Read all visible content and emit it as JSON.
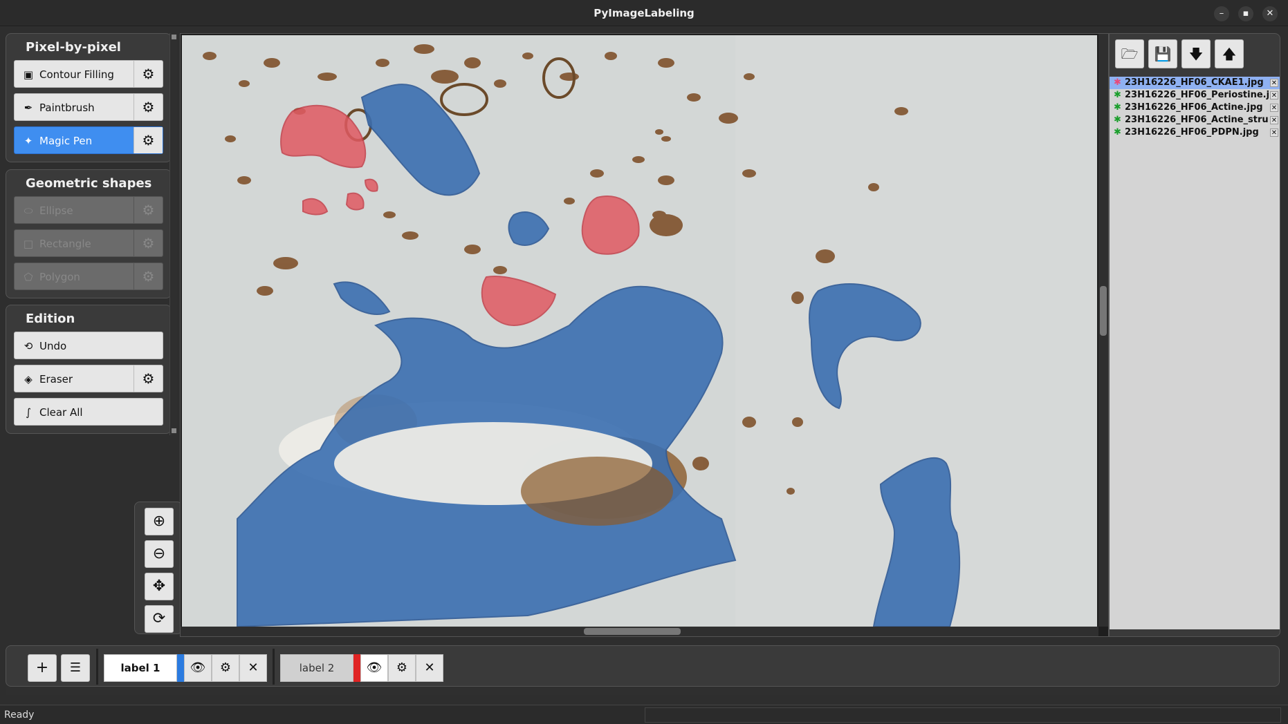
{
  "window": {
    "title": "PyImageLabeling",
    "controls": [
      "–",
      "▪",
      "✕"
    ]
  },
  "left_panel": {
    "groups": [
      {
        "title": "Pixel-by-pixel",
        "tools": [
          {
            "label": "Contour Filling",
            "icon": "bucket-icon",
            "state": "normal"
          },
          {
            "label": "Paintbrush",
            "icon": "paintbrush-icon",
            "state": "normal"
          },
          {
            "label": "Magic Pen",
            "icon": "magic-pen-icon",
            "state": "active"
          }
        ]
      },
      {
        "title": "Geometric shapes",
        "tools": [
          {
            "label": "Ellipse",
            "icon": "ellipse-icon",
            "state": "disabled"
          },
          {
            "label": "Rectangle",
            "icon": "rectangle-icon",
            "state": "disabled"
          },
          {
            "label": "Polygon",
            "icon": "polygon-icon",
            "state": "disabled"
          }
        ]
      },
      {
        "title": "Edition",
        "tools": [
          {
            "label": "Undo",
            "icon": "undo-icon",
            "state": "normal"
          },
          {
            "label": "Eraser",
            "icon": "eraser-icon",
            "state": "normal"
          },
          {
            "label": "Clear All",
            "icon": "clear-all-icon",
            "state": "normal"
          }
        ]
      }
    ]
  },
  "zoom_toolbar": [
    "zoom-in-icon",
    "zoom-out-icon",
    "pan-icon",
    "reset-view-icon"
  ],
  "file_panel": {
    "buttons": [
      "open-folder-icon",
      "save-icon",
      "download-icon",
      "upload-icon"
    ],
    "files": [
      {
        "name": "23H16226_HF06_CKAE1.jpg",
        "selected": true
      },
      {
        "name": "23H16226_HF06_Periostine.j",
        "selected": false
      },
      {
        "name": "23H16226_HF06_Actine.jpg",
        "selected": false
      },
      {
        "name": "23H16226_HF06_Actine_stru",
        "selected": false
      },
      {
        "name": "23H16226_HF06_PDPN.jpg",
        "selected": false
      }
    ]
  },
  "labels": [
    {
      "name": "label 1",
      "color": "#2b7be0",
      "active": true
    },
    {
      "name": "label 2",
      "color": "#e02424",
      "active": false
    }
  ],
  "colors": {
    "label1_overlay": "#3a6fb0",
    "label2_overlay": "#e05a62",
    "tissue": "#d4d8d8",
    "stain": "#7a4a22"
  },
  "status": {
    "text": "Ready"
  }
}
